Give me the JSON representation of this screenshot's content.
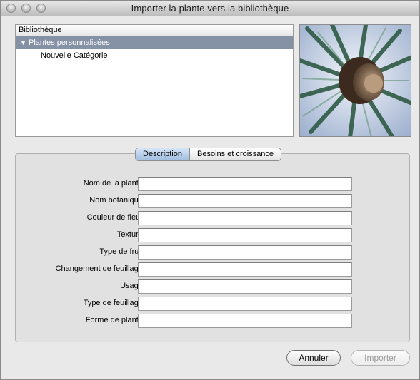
{
  "window": {
    "title": "Importer la plante vers la bibliothèque"
  },
  "library": {
    "header": "Bibliothèque",
    "selected_item": "Plantes personnalisées",
    "child_item": "Nouvelle Catégorie"
  },
  "tabs": [
    {
      "label": "Description",
      "active": true
    },
    {
      "label": "Besoins et croissance",
      "active": false
    }
  ],
  "form": {
    "fields": [
      {
        "label": "Nom de la plante :",
        "value": ""
      },
      {
        "label": "Nom botanique :",
        "value": ""
      },
      {
        "label": "Couleur de fleur :",
        "value": ""
      },
      {
        "label": "Texture :",
        "value": ""
      },
      {
        "label": "Type de fruit :",
        "value": ""
      },
      {
        "label": "Changement de feuillage :",
        "value": ""
      },
      {
        "label": "Usage :",
        "value": ""
      },
      {
        "label": "Type de feuillage :",
        "value": ""
      },
      {
        "label": "Forme de plante :",
        "value": ""
      }
    ]
  },
  "buttons": {
    "cancel": "Annuler",
    "import": "Importer"
  },
  "colors": {
    "selection": "#8592a6",
    "active_tab": "#b7cde9"
  }
}
